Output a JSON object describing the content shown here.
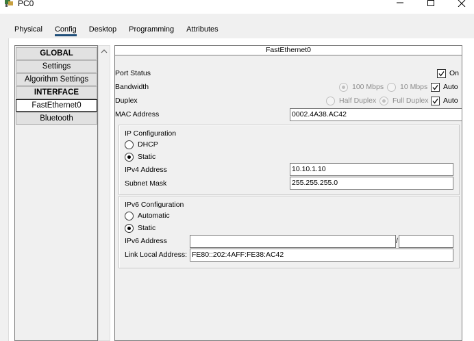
{
  "window": {
    "title": "PC0",
    "minimize": "—",
    "maximize": "☐",
    "close": "✕"
  },
  "tabs": [
    {
      "label": "Physical"
    },
    {
      "label": "Config"
    },
    {
      "label": "Desktop"
    },
    {
      "label": "Programming"
    },
    {
      "label": "Attributes"
    }
  ],
  "nav": {
    "global_header": "GLOBAL",
    "settings": "Settings",
    "algorithm_settings": "Algorithm Settings",
    "interface_header": "INTERFACE",
    "fastethernet": "FastEthernet0",
    "bluetooth": "Bluetooth"
  },
  "panel": {
    "title": "FastEthernet0",
    "port_status": {
      "label": "Port Status",
      "on_label": "On",
      "on_checked": true
    },
    "bandwidth": {
      "label": "Bandwidth",
      "opt100": "100 Mbps",
      "opt10": "10 Mbps",
      "auto_label": "Auto",
      "auto_checked": true
    },
    "duplex": {
      "label": "Duplex",
      "half": "Half Duplex",
      "full": "Full Duplex",
      "auto_label": "Auto",
      "auto_checked": true
    },
    "mac": {
      "label": "MAC Address",
      "value": "0002.4A38.AC42"
    },
    "ipv4": {
      "group_label": "IP Configuration",
      "dhcp": "DHCP",
      "static": "Static",
      "selected": "static",
      "address_label": "IPv4 Address",
      "address": "10.10.1.10",
      "mask_label": "Subnet Mask",
      "mask": "255.255.255.0"
    },
    "ipv6": {
      "group_label": "IPv6 Configuration",
      "automatic": "Automatic",
      "static": "Static",
      "selected": "static",
      "address_label": "IPv6 Address",
      "address": "",
      "separator": "/",
      "prefix": "",
      "link_local_label": "Link Local Address:",
      "link_local": "FE80::202:4AFF:FE38:AC42"
    }
  }
}
